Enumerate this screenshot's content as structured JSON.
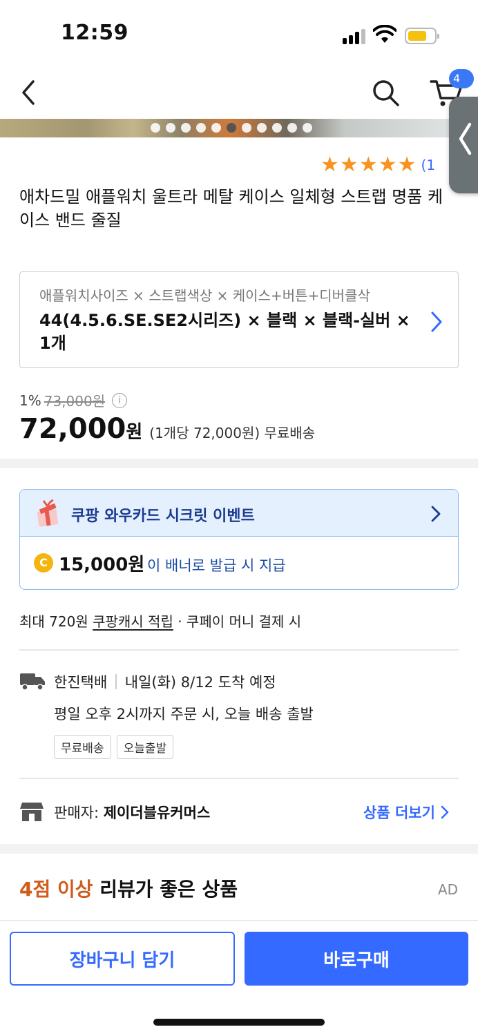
{
  "status_bar": {
    "time": "12:59"
  },
  "header": {
    "cart_badge": "4"
  },
  "gallery": {
    "dot_count": 11,
    "active_dot": 5
  },
  "product": {
    "rating_stars": 5,
    "review_count_visible": "(1",
    "title": "애차드밀 애플워치 울트라 메탈 케이스 일체형 스트랩 명품 케이스 밴드 줄질"
  },
  "option": {
    "header": "애플워치사이즈 × 스트랩색상 × 케이스+버튼+디버클삭",
    "selected": "44(4.5.6.SE.SE2시리즈) × 블랙 × 블랙-실버 × 1개"
  },
  "price": {
    "discount": "1%",
    "original": "73,000원",
    "current_number": "72,000",
    "current_unit": "원",
    "unit_price": "(1개당 72,000원) 무료배송"
  },
  "banner": {
    "title": "쿠팡 와우카드 시크릿 이벤트",
    "coin_letter": "C",
    "amount": "15,000원",
    "desc": "이 배너로 발급 시 지급"
  },
  "cash": {
    "prefix": "최대 720원 ",
    "link": "쿠팡캐시 적립",
    "suffix": " · 쿠페이 머니 결제 시"
  },
  "shipping": {
    "carrier": "한진택배",
    "arrival": "내일(화) 8/12 도착 예정",
    "sub": "평일 오후 2시까지 주문 시, 오늘 배송 출발",
    "chips": [
      "무료배송",
      "오늘출발"
    ]
  },
  "seller": {
    "label": "판매자: ",
    "name": "제이더블유커머스",
    "more": "상품 더보기"
  },
  "recommend": {
    "highlight": "4점 이상",
    "rest": " 리뷰가 좋은 상품",
    "ad": "AD"
  },
  "actions": {
    "cart": "장바구니 담기",
    "buy": "바로구매"
  },
  "colors": {
    "accent": "#346aff",
    "star": "#f7931e",
    "highlight": "#d15c1a",
    "coin": "#f6b40e"
  }
}
